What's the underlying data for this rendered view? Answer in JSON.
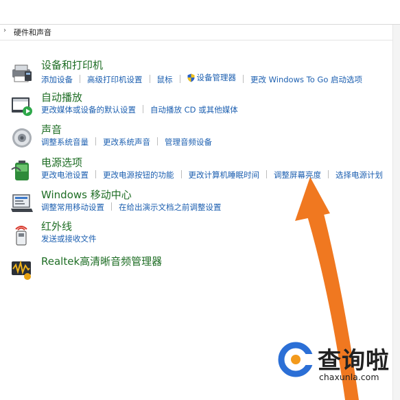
{
  "breadcrumb": {
    "label": "硬件和声音"
  },
  "categories": [
    {
      "title": "设备和打印机",
      "links": [
        "添加设备",
        "高级打印机设置",
        "鼠标",
        "设备管理器",
        "更改 Windows To Go 启动选项"
      ]
    },
    {
      "title": "自动播放",
      "links": [
        "更改媒体或设备的默认设置",
        "自动播放 CD 或其他媒体"
      ]
    },
    {
      "title": "声音",
      "links": [
        "调整系统音量",
        "更改系统声音",
        "管理音频设备"
      ]
    },
    {
      "title": "电源选项",
      "links": [
        "更改电池设置",
        "更改电源按钮的功能",
        "更改计算机睡眠时间",
        "调整屏幕亮度",
        "选择电源计划"
      ]
    },
    {
      "title": "Windows 移动中心",
      "links": [
        "调整常用移动设置",
        "在给出演示文档之前调整设置"
      ]
    },
    {
      "title": "红外线",
      "links": [
        "发送或接收文件"
      ]
    },
    {
      "title": "Realtek高清晰音频管理器",
      "links": []
    }
  ],
  "watermark": {
    "name": "查询啦",
    "domain": "chaxunla.com"
  },
  "colors": {
    "title_green": "#1e6d24",
    "link_blue": "#1c5fb0",
    "arrow_orange": "#f07820"
  },
  "icons": [
    "printer-icon",
    "autoplay-icon",
    "speaker-icon",
    "battery-icon",
    "mobility-center-icon",
    "infrared-icon",
    "audio-manager-icon",
    "shield-icon"
  ]
}
